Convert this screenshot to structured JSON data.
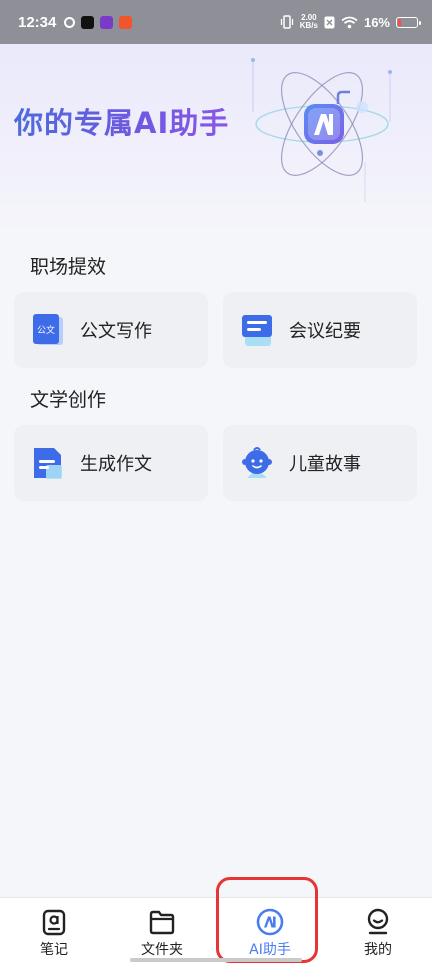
{
  "status_bar": {
    "time": "12:34",
    "net_speed_value": "2.00",
    "net_speed_unit": "KB/s",
    "battery": "16%"
  },
  "banner": {
    "title": "你的专属AI助手"
  },
  "sections": [
    {
      "title": "职场提效",
      "cards": [
        {
          "label": "公文写作",
          "icon": "document-writing-icon",
          "icon_text": "公文"
        },
        {
          "label": "会议纪要",
          "icon": "meeting-minutes-icon"
        }
      ]
    },
    {
      "title": "文学创作",
      "cards": [
        {
          "label": "生成作文",
          "icon": "essay-icon"
        },
        {
          "label": "儿童故事",
          "icon": "child-story-icon"
        }
      ]
    }
  ],
  "bottom_nav": {
    "items": [
      {
        "label": "笔记",
        "icon": "notes-icon"
      },
      {
        "label": "文件夹",
        "icon": "folder-icon"
      },
      {
        "label": "AI助手",
        "icon": "ai-assistant-icon",
        "active": true
      },
      {
        "label": "我的",
        "icon": "profile-icon"
      }
    ]
  },
  "colors": {
    "accent": "#4a7cf0",
    "highlight": "#e53535",
    "card_bg": "#eff0f4"
  }
}
